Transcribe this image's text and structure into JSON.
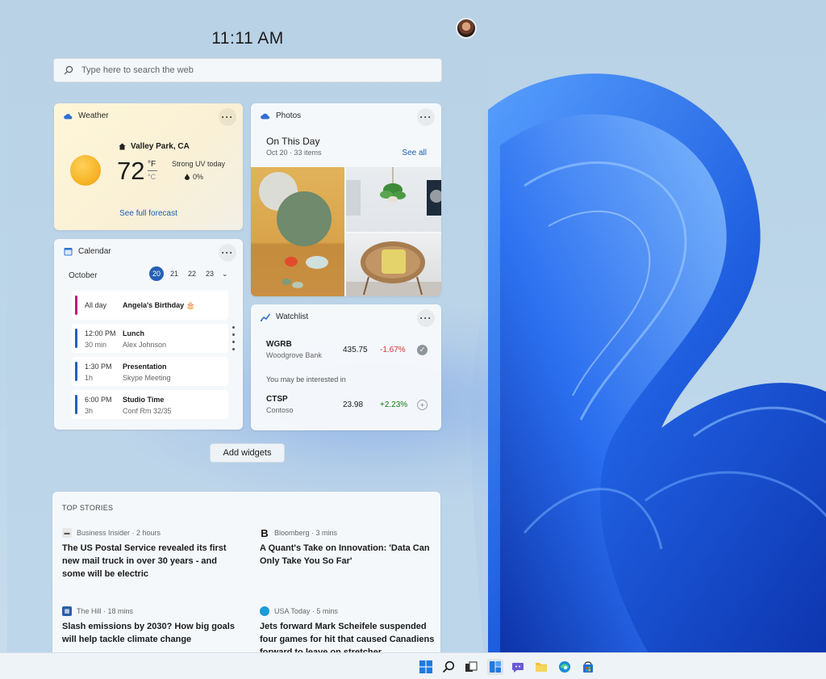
{
  "clock": "11:11 AM",
  "search": {
    "placeholder": "Type here to search the web"
  },
  "weather": {
    "title": "Weather",
    "location": "Valley Park, CA",
    "temperature": "72",
    "unit_f": "°F",
    "unit_c": "°C",
    "condition": "Strong UV today",
    "precip": "0%",
    "link": "See full forecast"
  },
  "calendar": {
    "title": "Calendar",
    "month": "October",
    "days": [
      "20",
      "21",
      "22",
      "23"
    ],
    "selected_day": "20",
    "events": [
      {
        "time": "All day",
        "duration": "",
        "title": "Angela's Birthday 🎂",
        "detail": "",
        "color": "#c3137a"
      },
      {
        "time": "12:00 PM",
        "duration": "30 min",
        "title": "Lunch",
        "detail": "Alex Johnson",
        "color": "#2460b5"
      },
      {
        "time": "1:30 PM",
        "duration": "1h",
        "title": "Presentation",
        "detail": "Skype Meeting",
        "color": "#2460b5"
      },
      {
        "time": "6:00 PM",
        "duration": "3h",
        "title": "Studio Time",
        "detail": "Conf Rm 32/35",
        "color": "#2460b5"
      }
    ]
  },
  "photos": {
    "title": "Photos",
    "heading": "On This Day",
    "subtitle": "Oct 20 · 33 items",
    "link": "See all"
  },
  "watchlist": {
    "title": "Watchlist",
    "stocks": [
      {
        "symbol": "WGRB",
        "name": "Woodgrove Bank",
        "price": "435.75",
        "change": "-1.67%",
        "change_color": "#d13438"
      }
    ],
    "interest_label": "You may be interested in",
    "suggestions": [
      {
        "symbol": "CTSP",
        "name": "Contoso",
        "price": "23.98",
        "change": "+2.23%",
        "change_color": "#107c10"
      }
    ]
  },
  "add_widgets": "Add widgets",
  "top_stories": {
    "heading": "TOP STORIES",
    "items": [
      {
        "source": "Business Insider · 2 hours",
        "headline": "The US Postal Service revealed its first new mail truck in over 30 years - and some will be electric"
      },
      {
        "source": "Bloomberg · 3 mins",
        "headline": "A Quant's Take on Innovation: 'Data Can Only Take You So Far'"
      },
      {
        "source": "The Hill · 18 mins",
        "headline": "Slash emissions by 2030? How big goals will help tackle climate change"
      },
      {
        "source": "USA Today · 5 mins",
        "headline": "Jets forward Mark Scheifele suspended four games for hit that caused Canadiens forward to leave on stretcher"
      }
    ]
  },
  "taskbar": {
    "icons": [
      "start-icon",
      "search-icon",
      "task-view-icon",
      "widgets-icon",
      "chat-icon",
      "file-explorer-icon",
      "edge-icon",
      "store-icon"
    ]
  },
  "colors": {
    "accent": "#2460b5",
    "link": "#1a5fb4",
    "bloom": "#1f5fe0"
  }
}
